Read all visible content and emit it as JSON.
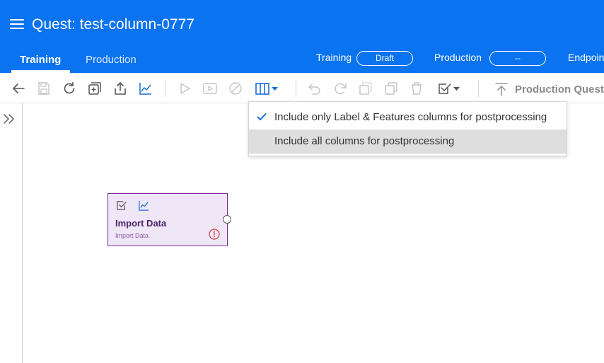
{
  "header": {
    "title": "Quest: test-column-0777",
    "tabs": [
      {
        "label": "Training",
        "active": true
      },
      {
        "label": "Production",
        "active": false
      }
    ],
    "statuses": [
      {
        "label": "Training",
        "value": "Draft"
      },
      {
        "label": "Production",
        "value": "--"
      },
      {
        "label": "Endpoint"
      }
    ],
    "brand_color": "#0a73f0"
  },
  "toolbar": {
    "icons": [
      "back-arrow-icon",
      "save-icon",
      "refresh-icon",
      "add-node-icon",
      "export-icon",
      "chart-icon",
      "play-icon",
      "play-step-icon",
      "stop-icon",
      "columns-icon",
      "undo-icon",
      "redo-icon",
      "copy-icon",
      "duplicate-icon",
      "trash-icon",
      "validate-icon"
    ],
    "production_quest_label": "Production Quest"
  },
  "dropdown": {
    "options": [
      {
        "label": "Include only Label & Features columns for postprocessing",
        "selected": true
      },
      {
        "label": "Include all columns for postprocessing",
        "selected": false,
        "highlighted": true
      }
    ]
  },
  "canvas": {
    "node": {
      "title": "Import Data",
      "subtitle": "Import Data",
      "status": "warning",
      "color": "#7a2d8e"
    }
  }
}
